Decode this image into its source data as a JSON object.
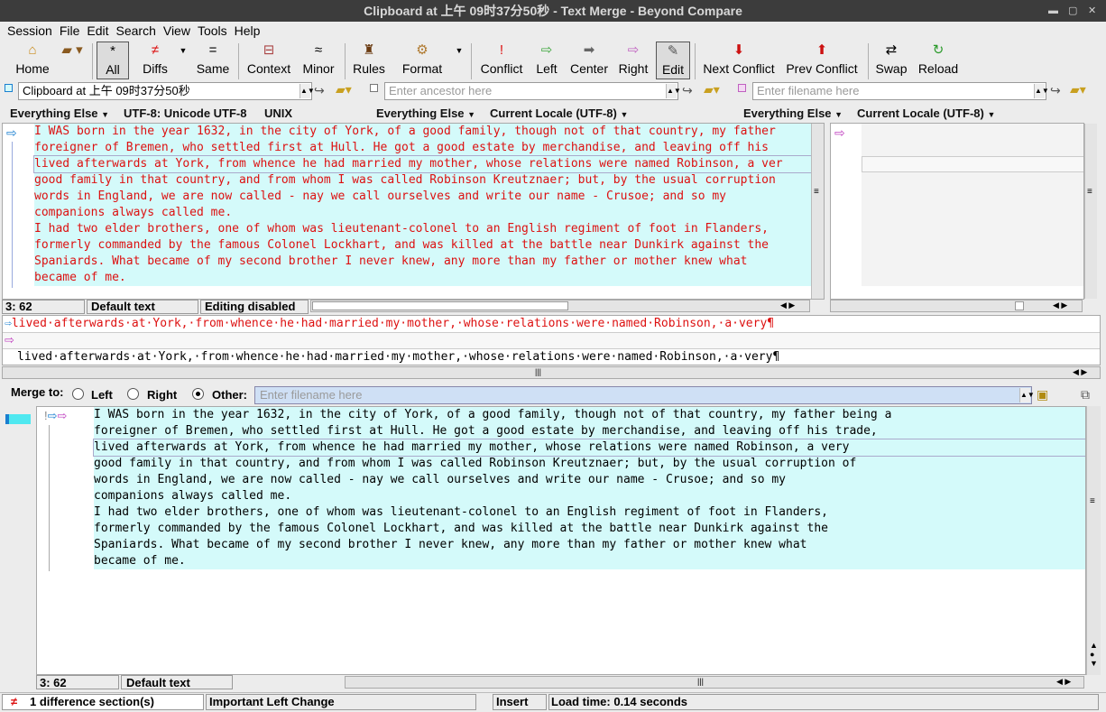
{
  "window": {
    "title": "Clipboard at 上午 09时37分50秒 - Text Merge - Beyond Compare"
  },
  "menu": [
    "Session",
    "File",
    "Edit",
    "Search",
    "View",
    "Tools",
    "Help"
  ],
  "toolbar": {
    "home": "Home",
    "all": "All",
    "diffs": "Diffs",
    "same": "Same",
    "context": "Context",
    "minor": "Minor",
    "rules": "Rules",
    "format": "Format",
    "conflict": "Conflict",
    "left": "Left",
    "center": "Center",
    "right": "Right",
    "edit": "Edit",
    "next_conflict": "Next Conflict",
    "prev_conflict": "Prev Conflict",
    "swap": "Swap",
    "reload": "Reload"
  },
  "paths": {
    "left": "Clipboard at 上午 09时37分50秒",
    "ancestor_placeholder": "Enter ancestor here",
    "right_placeholder": "Enter filename here"
  },
  "format_bar": {
    "left_type": "Everything Else",
    "left_encoding": "UTF-8: Unicode UTF-8",
    "left_eol": "UNIX",
    "center_type": "Everything Else",
    "center_encoding": "Current Locale (UTF-8)",
    "right_type": "Everything Else",
    "right_encoding": "Current Locale (UTF-8)"
  },
  "left_lines": [
    "I WAS born in the year 1632, in the city of York, of a good family, though not of that country, my father",
    "foreigner of Bremen, who settled first at Hull. He got a good estate by merchandise, and leaving off his",
    "lived afterwards at York, from whence he had married my mother, whose relations were named Robinson, a ver",
    "good family in that country, and from whom I was called Robinson Kreutznaer; but, by the usual corruption",
    "words in England, we are now called - nay we call ourselves and write our name - Crusoe; and so my",
    "companions always called me.",
    "I had two elder brothers, one of whom was lieutenant-colonel to an English regiment of foot in Flanders,",
    "formerly commanded by the famous Colonel Lockhart, and was killed at the battle near Dunkirk against the",
    "Spaniards. What became of my second brother I never knew, any more than my father or mother knew what",
    "became of me."
  ],
  "left_status": {
    "pos": "3: 62",
    "mode": "Default text",
    "edit": "Editing disabled"
  },
  "detail": {
    "line1": "lived·afterwards·at·York,·from·whence·he·had·married·my·mother,·whose·relations·were·named·Robinson,·a·very¶",
    "line3": "lived·afterwards·at·York,·from·whence·he·had·married·my·mother,·whose·relations·were·named·Robinson,·a·very¶"
  },
  "merge": {
    "label": "Merge to:",
    "left": "Left",
    "right": "Right",
    "other": "Other:",
    "placeholder": "Enter filename here"
  },
  "output_lines": [
    "I WAS born in the year 1632, in the city of York, of a good family, though not of that country, my father being a",
    "foreigner of Bremen, who settled first at Hull. He got a good estate by merchandise, and leaving off his trade,",
    "lived afterwards at York, from whence he had married my mother, whose relations were named Robinson, a very",
    "good family in that country, and from whom I was called Robinson Kreutznaer; but, by the usual corruption of",
    "words in England, we are now called - nay we call ourselves and write our name - Crusoe; and so my",
    "companions always called me.",
    "I had two elder brothers, one of whom was lieutenant-colonel to an English regiment of foot in Flanders,",
    "formerly commanded by the famous Colonel Lockhart, and was killed at the battle near Dunkirk against the",
    "Spaniards. What became of my second brother I never knew, any more than my father or mother knew what",
    "became of me."
  ],
  "output_status": {
    "pos": "3: 62",
    "mode": "Default text"
  },
  "statusbar": {
    "diffs": "1 difference section(s)",
    "change": "Important Left Change",
    "insert": "Insert",
    "load": "Load time: 0.14 seconds"
  },
  "colors": {
    "diff_bg": "#d4fafa",
    "conflict_text": "#dd1111",
    "title_bg": "#3c3c3c"
  }
}
